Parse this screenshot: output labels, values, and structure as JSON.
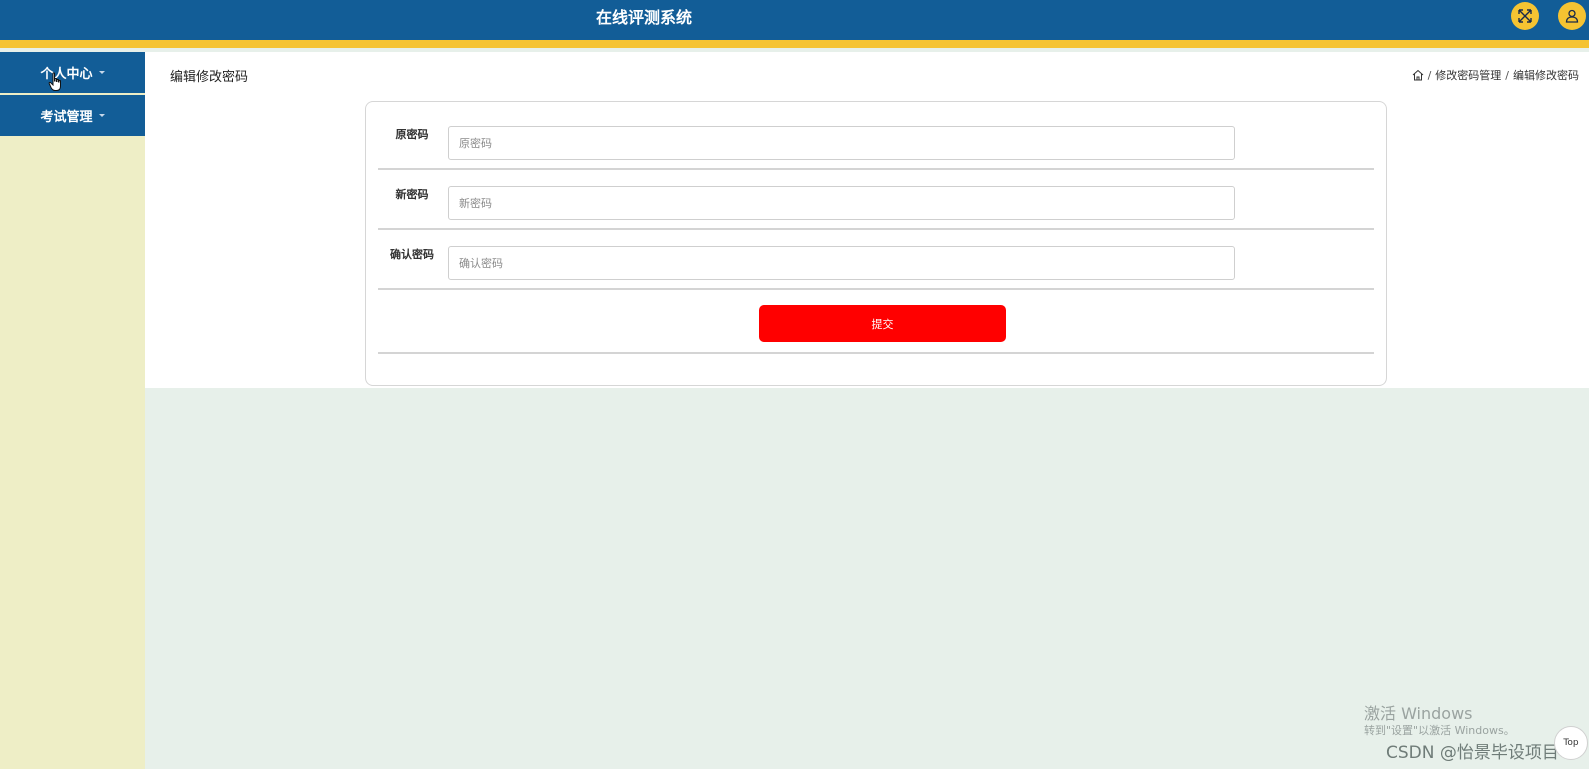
{
  "header": {
    "title": "在线评测系统",
    "fullscreen_icon": "expand-arrows-icon",
    "user_icon": "user-icon"
  },
  "sidebar": {
    "items": [
      {
        "label": "个人中心"
      },
      {
        "label": "考试管理"
      }
    ]
  },
  "page": {
    "title": "编辑修改密码",
    "breadcrumb": {
      "home_icon": "home-icon",
      "separator": "/",
      "items": [
        "修改密码管理",
        "编辑修改密码"
      ]
    }
  },
  "form": {
    "fields": [
      {
        "label": "原密码",
        "placeholder": "原密码",
        "value": ""
      },
      {
        "label": "新密码",
        "placeholder": "新密码",
        "value": ""
      },
      {
        "label": "确认密码",
        "placeholder": "确认密码",
        "value": ""
      }
    ],
    "submit_label": "提交"
  },
  "overlay": {
    "windows_activate_title": "激活 Windows",
    "windows_activate_sub": "转到\"设置\"以激活 Windows。",
    "csdn_watermark": "CSDN @怡景毕设项目",
    "top_button_label": "Top"
  },
  "colors": {
    "header": "#125d97",
    "accent_stripe": "#f5c332",
    "sidebar_bg": "#eeeec6",
    "page_bg": "#e7f0ea",
    "submit": "#ff0000"
  }
}
